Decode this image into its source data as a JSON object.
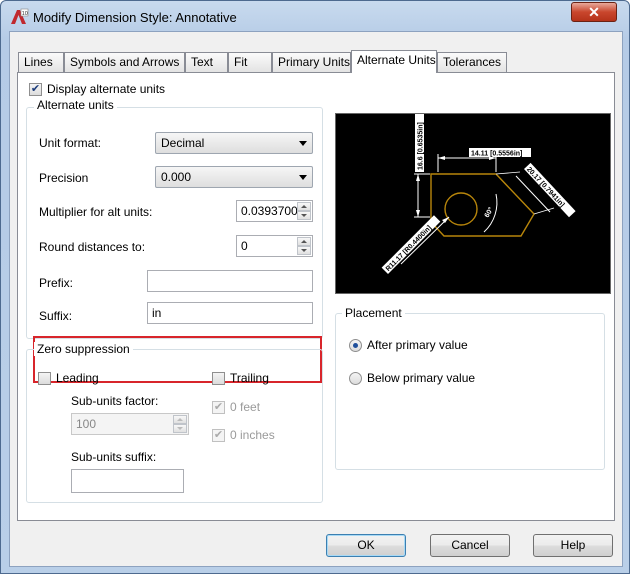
{
  "window": {
    "title": "Modify Dimension Style: Annotative",
    "close_glyph": "✕"
  },
  "tabs": [
    {
      "label": "Lines"
    },
    {
      "label": "Symbols and Arrows"
    },
    {
      "label": "Text"
    },
    {
      "label": "Fit"
    },
    {
      "label": "Primary Units"
    },
    {
      "label": "Alternate Units"
    },
    {
      "label": "Tolerances"
    }
  ],
  "display_alt": {
    "label": "Display alternate units",
    "checked": true
  },
  "alt_units": {
    "title": "Alternate units",
    "unit_format": {
      "label": "Unit format:",
      "value": "Decimal"
    },
    "precision": {
      "label": "Precision",
      "value": "0.000"
    },
    "multiplier": {
      "label": "Multiplier for alt units:",
      "value": "0.0393700"
    },
    "round": {
      "label": "Round distances  to:",
      "value": "0"
    },
    "prefix": {
      "label": "Prefix:",
      "value": ""
    },
    "suffix": {
      "label": "Suffix:",
      "value": "in"
    }
  },
  "zero_suppression": {
    "title": "Zero suppression",
    "leading": "Leading",
    "trailing": "Trailing",
    "sub_units_factor": {
      "label": "Sub-units factor:",
      "value": "100"
    },
    "zero_feet": "0 feet",
    "zero_inches": "0 inches",
    "sub_units_suffix": {
      "label": "Sub-units suffix:",
      "value": ""
    }
  },
  "placement": {
    "title": "Placement",
    "after": "After primary value",
    "below": "Below primary value"
  },
  "preview": {
    "dim_top": "14.11 [0.5556in]",
    "dim_left": "16.6 [0.6535in]",
    "dim_right": "20.17 [0.7941in]",
    "dim_radius": "R11.17 [R0.4400in]",
    "dim_angle": "60°"
  },
  "buttons": {
    "ok": "OK",
    "cancel": "Cancel",
    "help": "Help"
  },
  "colors": {
    "highlight": "#d8252b",
    "preview_bg": "#000000",
    "preview_part": "#b8860b"
  }
}
